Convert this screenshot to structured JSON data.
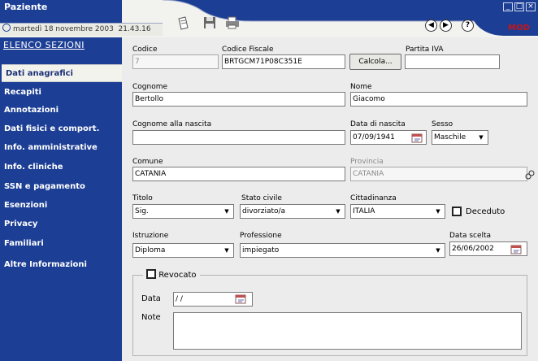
{
  "header": {
    "title": "Paziente",
    "date": "martedì 18 novembre 2003",
    "time": "21.43.16",
    "mode": "MOD",
    "toolbar": [
      "paste-icon",
      "save-icon",
      "print-icon"
    ],
    "nav_icons": [
      "back-icon",
      "forward-icon",
      "help-icon"
    ],
    "window_controls": [
      "minimize-icon",
      "maximize-icon",
      "close-icon"
    ],
    "colors": {
      "brand": "#1c3f95",
      "mode": "#c81414",
      "panel": "#ececec"
    }
  },
  "sidebar": {
    "heading": "ELENCO SEZIONI",
    "items": [
      "Dati anagrafici",
      "Recapiti",
      "Annotazioni",
      "Dati fisici e comport.",
      "Info. amministrative",
      "Info. cliniche",
      "SSN e pagamento",
      "Esenzioni",
      "Privacy",
      "Familiari",
      "Altre Informazioni"
    ],
    "active_index": 0
  },
  "form": {
    "codice": {
      "label": "Codice",
      "value": "7"
    },
    "codice_fiscale": {
      "label": "Codice Fiscale",
      "value": "BRTGCM71P08C351E"
    },
    "calcola": "Calcola...",
    "partita_iva": {
      "label": "Partita IVA",
      "value": ""
    },
    "cognome": {
      "label": "Cognome",
      "value": "Bertollo"
    },
    "nome": {
      "label": "Nome",
      "value": "Giacomo"
    },
    "cognome_nascita": {
      "label": "Cognome alla nascita",
      "value": ""
    },
    "data_nascita": {
      "label": "Data di nascita",
      "value": "07/09/1941"
    },
    "sesso": {
      "label": "Sesso",
      "value": "Maschile"
    },
    "comune": {
      "label": "Comune",
      "value": "CATANIA"
    },
    "provincia": {
      "label": "Provincia",
      "value": "CATANIA"
    },
    "titolo": {
      "label": "Titolo",
      "value": "Sig."
    },
    "stato_civile": {
      "label": "Stato civile",
      "value": "divorziato/a"
    },
    "cittadinanza": {
      "label": "Cittadinanza",
      "value": "ITALIA"
    },
    "deceduto": "Deceduto",
    "istruzione": {
      "label": "Istruzione",
      "value": "Diploma"
    },
    "professione": {
      "label": "Professione",
      "value": "impiegato"
    },
    "data_scelta": {
      "label": "Data scelta",
      "value": "26/06/2002"
    },
    "revocato": {
      "label": "Revocato",
      "data_label": "Data",
      "data_value": "/ /",
      "note_label": "Note",
      "note_value": ""
    }
  }
}
